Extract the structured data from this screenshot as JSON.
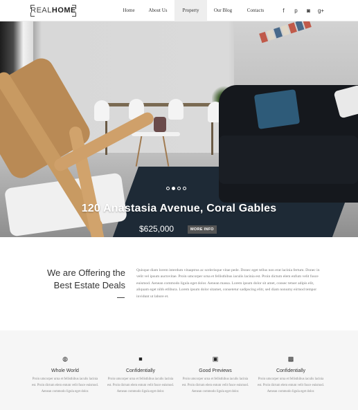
{
  "header": {
    "logo": {
      "light": "REAL",
      "bold": "HOME"
    },
    "nav": [
      "Home",
      "About Us",
      "Property",
      "Our Blog",
      "Contacts"
    ],
    "active_nav": "Property",
    "social_icons": [
      "facebook-icon",
      "pinterest-icon",
      "instagram-icon",
      "google-plus-icon"
    ],
    "social_glyphs": [
      "f",
      "p",
      "◙",
      "g+"
    ]
  },
  "hero": {
    "title": "120 Anastasia Avenue, Coral Gables",
    "price": "$625,000",
    "more_button": "MORE INFO",
    "slides": 4,
    "active_slide": 2
  },
  "offer": {
    "title_line1": "We are Offering the",
    "title_line2": "Best Estate Deals",
    "text": "Quisque diam lorem interdum vitaaptrus ac scelerisque vitae pede. Donec eget tellus non erat lacinia fertum. Donec in velit vel ipsum auctovitae. Proin umcorper urna et fellisthibus iaculis lacinia est. Proin dictum elem enfum velit fusce euismod. Aenean commodo ligula eget dolor. Aenean massa. Lorem ipsum dolor sit amet, consec tetuer adipis elit, aliquam eget nibh etlibura. Lorem ipsum dolor sitamet, consetetur sadipscing elitr, sed diam nonumy eirmod tempor invidunt ut labore et."
  },
  "features": [
    {
      "icon": "globe-icon",
      "glyph": "◍",
      "title": "Whole World",
      "text": "Proin umcorper urna et fellisthibus iaculis lacinia est. Proin dictum elem entum velit fusce euismod. Aenean commodo ligula eget dolor."
    },
    {
      "icon": "briefcase-icon",
      "glyph": "■",
      "title": "Confidentially",
      "text": "Proin umcorper urna et fellisthibus iaculis lacinia est. Proin dictum elem entum velit fusce euismod. Aenean commodo ligula eget dolor."
    },
    {
      "icon": "picture-icon",
      "glyph": "▣",
      "title": "Good Previews",
      "text": "Proin umcorper urna et fellisthibus iaculis lacinia est. Proin dictum elem entum velit fusce euismod. Aenean commodo ligula eget dolor."
    },
    {
      "icon": "suitcase-icon",
      "glyph": "▩",
      "title": "Confidentially",
      "text": "Proin umcorper urna et fellisthibus iaculis lacinia est. Proin dictum elem entum velit fusce euismod. Aenean commodo ligula eget dolor."
    }
  ]
}
